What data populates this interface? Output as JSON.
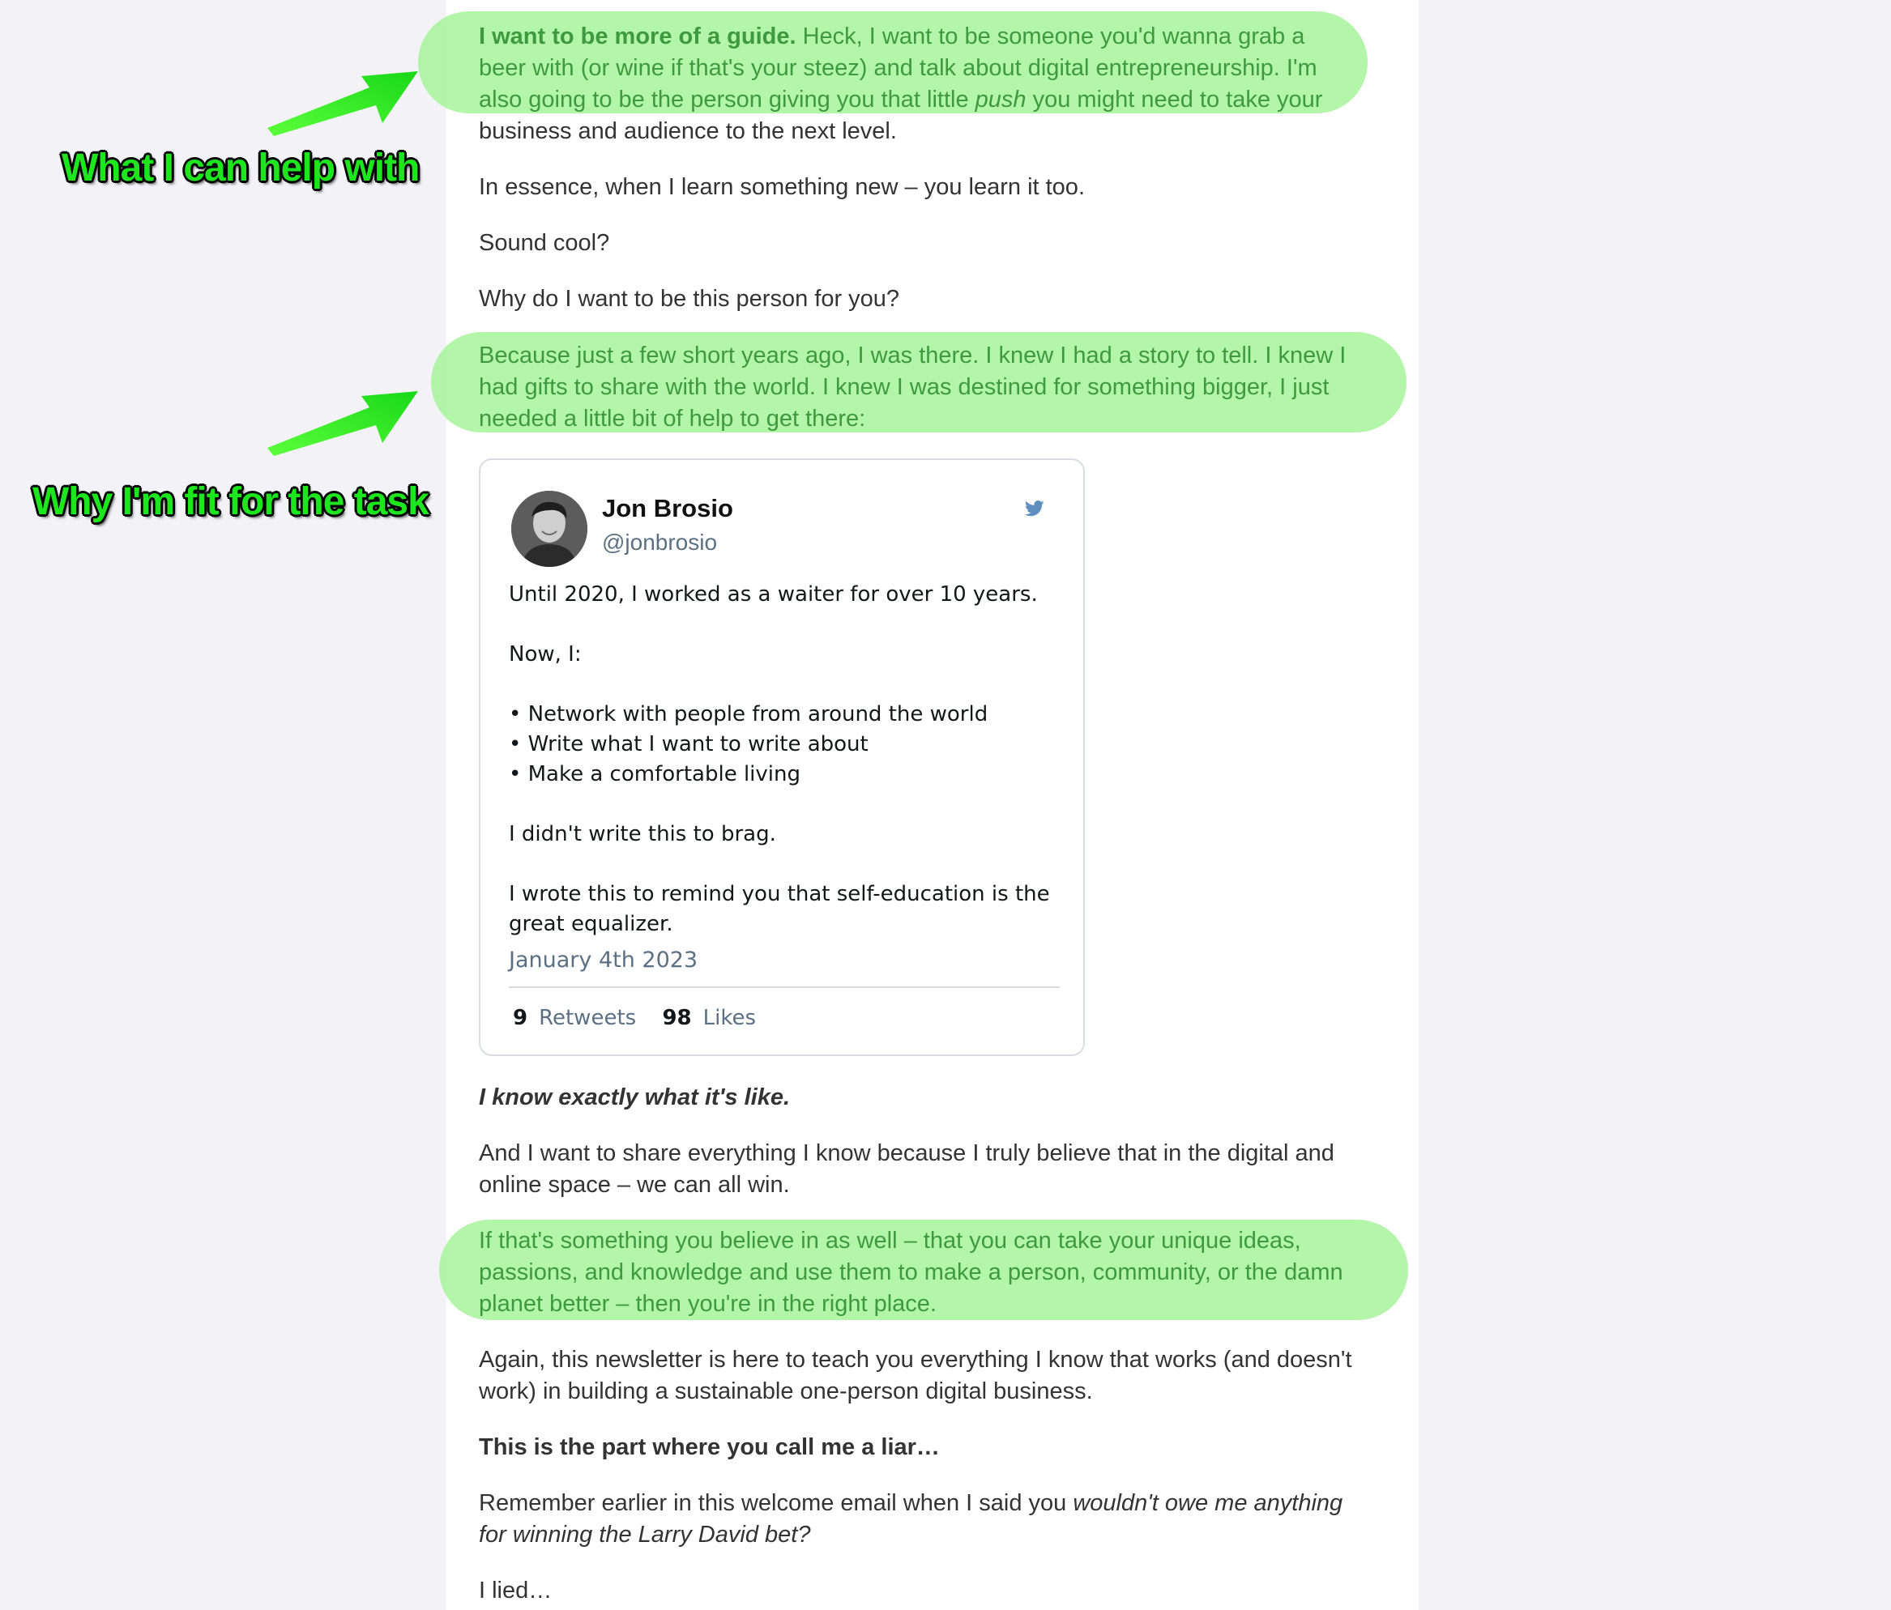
{
  "highlight_color": "#a6f59a",
  "annotation_color": "#1ee61e",
  "annotations": {
    "help": "What I can help with",
    "fit": "Why I'm fit for the task"
  },
  "email": {
    "p1_bold": "I want to be more of a guide.",
    "p1_line1_rest": " Heck, I want to be someone you'd wanna grab a",
    "p1_line2": "beer with (or wine if that's your steez) and talk about digital entrepreneurship. I'm",
    "p1_line3_pre": "also going to be the person giving you that little ",
    "p1_line3_em": "push",
    "p1_line3_post": " you might need to take your",
    "p1_line4": "business and audience to the next level.",
    "p2": "In essence, when I learn something new – you learn it too.",
    "p3": "Sound cool?",
    "p4": "Why do I want to be this person for you?",
    "p5_line1": "Because just a few short years ago, I was there. I knew I had a story to tell. I knew I",
    "p5_line2": "had gifts to share with the world. I knew I was destined for something bigger, I just",
    "p5_line3": "needed a little bit of help to get there:",
    "p6": "I know exactly what it's like.",
    "p7_line1": "And I want to share everything I know because I truly believe that in the digital and",
    "p7_line2": "online space – we can all win.",
    "p8_line1": "If that's something you believe in as well – that you can take your unique ideas,",
    "p8_line2": "passions, and knowledge and use them to make a person, community, or the damn",
    "p8_line3": "planet better – then you're in the right place.",
    "p9_line1": "Again, this newsletter is here to teach you everything I know that works (and doesn't",
    "p9_line2": "work) in building a sustainable one-person digital business.",
    "p10": "This is the part where you call me a liar…",
    "p11_line1_pre": "Remember earlier in this welcome email when I said you ",
    "p11_line1_em": "wouldn't owe me anything",
    "p11_line2_em": "for winning the Larry David bet?",
    "p12": "I lied…"
  },
  "tweet": {
    "author_name": "Jon Brosio",
    "author_handle": "@jonbrosio",
    "body": "Until 2020, I worked as a waiter for over 10 years.\n\nNow, I:\n\n• Network with people from around the world\n• Write what I want to write about\n• Make a comfortable living\n\nI didn't write this to brag.\n\nI wrote this to remind you that self-education is the\ngreat equalizer.",
    "date": "January 4th 2023",
    "retweets_count": "9",
    "retweets_label": "Retweets",
    "likes_count": "98",
    "likes_label": "Likes"
  },
  "icons": {
    "twitter": "twitter-bird-icon",
    "arrow": "green-arrow-icon"
  }
}
